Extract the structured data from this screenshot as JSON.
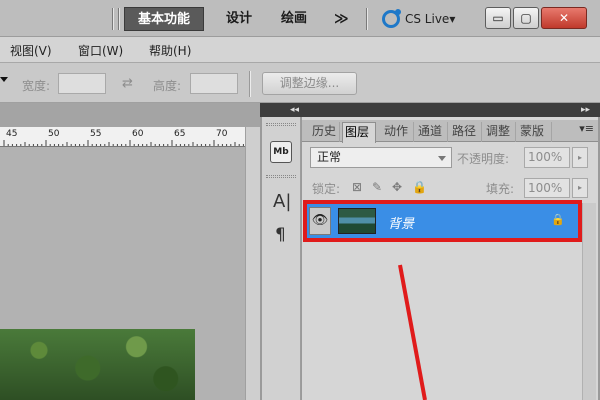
{
  "workspace": {
    "essentials": "基本功能",
    "design": "设计",
    "painting": "绘画",
    "more": "≫",
    "cs_live": "CS Live▾"
  },
  "window_controls": {
    "minimize": "▭",
    "maximize": "▢",
    "close": "✕"
  },
  "menu": {
    "items": [
      "视图(V)",
      "窗口(W)",
      "帮助(H)"
    ]
  },
  "options": {
    "width_label": "宽度:",
    "height_label": "高度:",
    "swap": "⇄",
    "refine_edge": "调整边缘..."
  },
  "ruler": {
    "labels": [
      "45",
      "50",
      "55",
      "60",
      "65",
      "70"
    ]
  },
  "dock": {
    "collapse": "◂◂",
    "expand": "▸▸",
    "strip_icons": {
      "mini_bridge": "Mb",
      "character": "A|",
      "paragraph": "¶"
    }
  },
  "layers_panel": {
    "tabs": [
      "历史",
      "图层",
      "动作",
      "通道",
      "路径",
      "调整",
      "蒙版"
    ],
    "active_tab": "图层",
    "menu_icon": "▾≡",
    "blend_mode": "正常",
    "opacity_label": "不透明度:",
    "opacity_value": "100%",
    "lock_label": "锁定:",
    "lock_icons": [
      "⊠",
      "✎",
      "✥",
      "🔒"
    ],
    "fill_label": "填充:",
    "fill_value": "100%",
    "stepper": "▸",
    "layer": {
      "name": "背景",
      "visibility": "👁",
      "lock": "🔒"
    }
  },
  "colors": {
    "selection": "#3a8ee6",
    "annotation": "#e01b1b"
  }
}
